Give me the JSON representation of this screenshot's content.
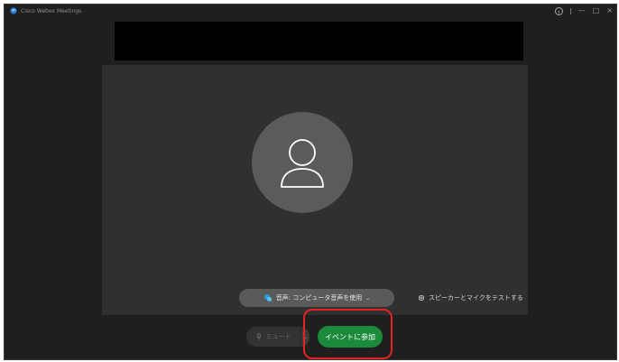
{
  "window": {
    "title": "Cisco Webex Meetings",
    "controls": {
      "help": "?",
      "minimize": "—",
      "maximize": "□",
      "close": "×"
    }
  },
  "preview": {
    "audio_button_label": "音声: コンピュータ音声を使用",
    "audio_button_chevron": "⌄",
    "speaker_test_label": "スピーカーとマイクをテストする"
  },
  "controls": {
    "mute_label": "ミュート",
    "mute_dropdown_chevron": "⌄",
    "join_label": "イベントに参加"
  },
  "colors": {
    "window_bg": "#1f1f1f",
    "video_bg": "#303030",
    "avatar_bg": "#5b5b5b",
    "join_green": "#1b8a3a",
    "highlight_red": "#e32222"
  }
}
